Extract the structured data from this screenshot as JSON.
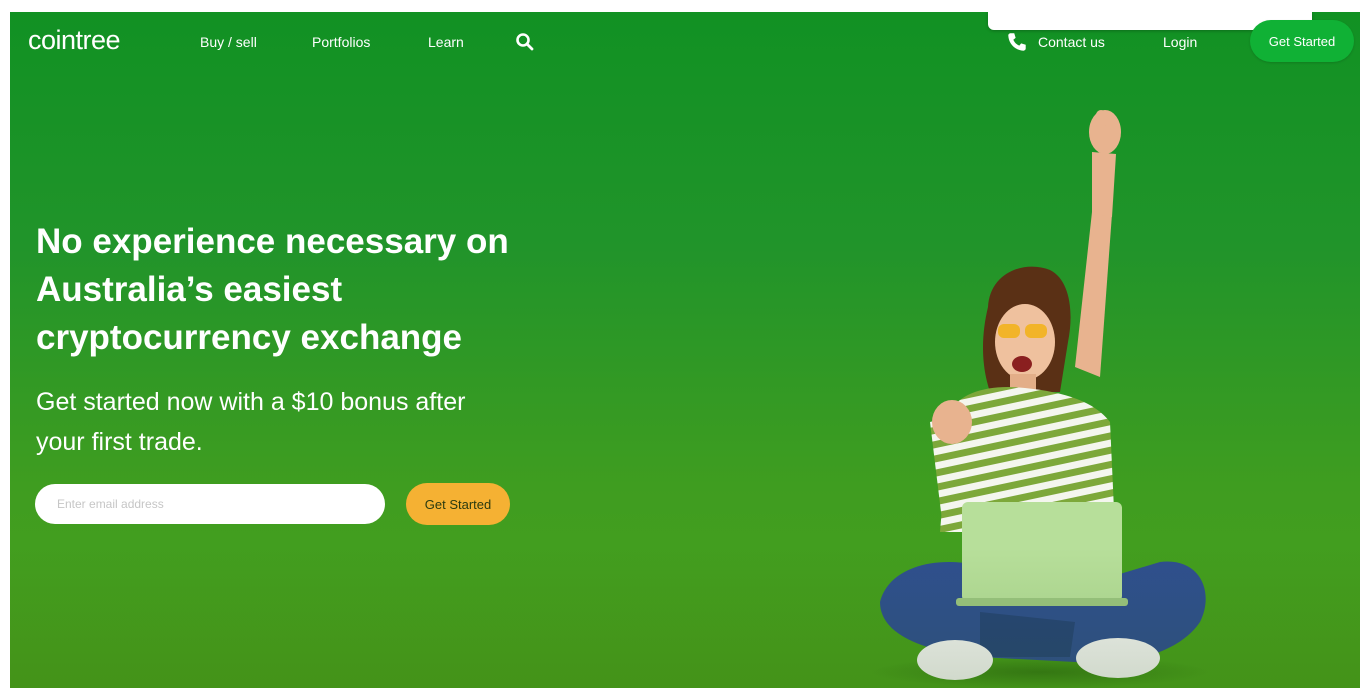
{
  "nav": {
    "logo": "cointree",
    "links": [
      "Buy / sell",
      "Portfolios",
      "Learn"
    ],
    "search_icon": "search-icon",
    "contact": {
      "icon": "phone-icon",
      "label": "Contact us"
    },
    "login": "Login",
    "cta": "Get Started"
  },
  "hero": {
    "headline": "No experience necessary on Australia’s easiest cryptocurrency exchange",
    "subline": "Get started now with a $10 bonus after your first trade.",
    "email_placeholder": "Enter email address",
    "email_value": "",
    "cta": "Get Started"
  },
  "colors": {
    "brand_green": "#119123",
    "nav_cta": "#10b135",
    "hero_cta": "#f5b133"
  }
}
